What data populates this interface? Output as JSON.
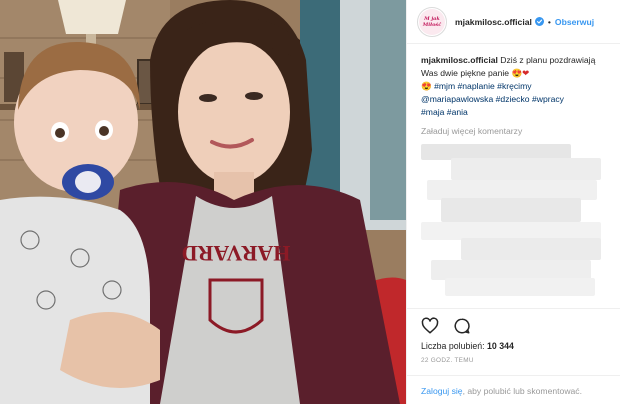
{
  "post": {
    "username": "mjakmilosc.official",
    "follow_label": "Obserwuj",
    "separator": "•",
    "avatar_text": "M jak Miłość",
    "caption": {
      "username": "mjakmilosc.official",
      "text_1": " Dziś z planu pozdrawiają Was dwie piękne panie ",
      "emoji_1": "😍❤",
      "emoji_2": "😍",
      "hashtags": [
        "#mjm",
        "#naplanie",
        "#kręcimy",
        "@mariapawlowska",
        "#dziecko",
        "#wpracy",
        "#maja",
        "#ania"
      ]
    },
    "load_more": "Załaduj więcej komentarzy",
    "likes_label": "Liczba polubień: ",
    "likes_count": "10 344",
    "timestamp": "22 GODZ. TEMU",
    "login_link": "Zaloguj się",
    "login_rest": ", aby polubić lub skomentować.",
    "colors": {
      "link_blue": "#3897f0",
      "hashtag_blue": "#003569",
      "muted_gray": "#999999",
      "text": "#262626"
    },
    "icons": [
      "heart-icon",
      "comment-icon",
      "verified-badge-icon"
    ]
  }
}
